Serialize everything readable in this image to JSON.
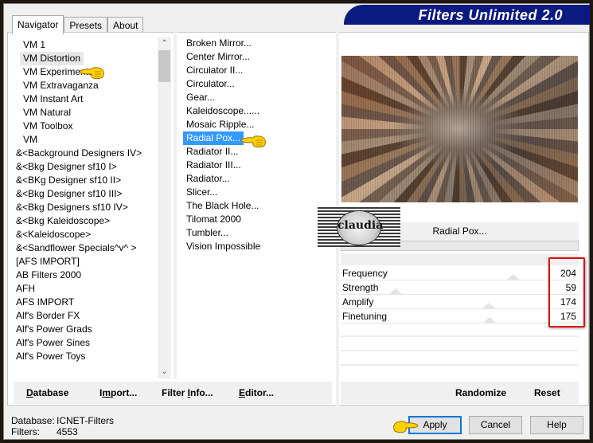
{
  "window": {
    "title": "Filters Unlimited 2.0"
  },
  "tabs": [
    {
      "label": "Navigator",
      "active": true
    },
    {
      "label": "Presets",
      "active": false
    },
    {
      "label": "About",
      "active": false
    }
  ],
  "categories": {
    "selected": "VM Distortion",
    "items": [
      "VM 1",
      "VM Distortion",
      "VM Experimental",
      "VM Extravaganza",
      "VM Instant Art",
      "VM Natural",
      "VM Toolbox",
      "VM",
      "&<Background Designers IV>",
      "&<Bkg Designer sf10 I>",
      "&<BKg Designer sf10 II>",
      "&<Bkg Designer sf10 III>",
      "&<Bkg Designers sf10 IV>",
      "&<Bkg Kaleidoscope>",
      "&<Kaleidoscope>",
      "&<Sandflower Specials^v^ >",
      "[AFS IMPORT]",
      "AB Filters 2000",
      "AFH",
      "AFS IMPORT",
      "Alf's Border FX",
      "Alf's Power Grads",
      "Alf's Power Sines",
      "Alf's Power Toys"
    ]
  },
  "filters": {
    "selected": "Radial Pox...",
    "items": [
      "Broken Mirror...",
      "Center Mirror...",
      "Circulator II...",
      "Circulator...",
      "Gear...",
      "Kaleidoscope......",
      "Mosaic Ripple...",
      "Radial Pox...",
      "Radiator II...",
      "Radiator III...",
      "Radiator...",
      "Slicer...",
      "The Black Hole...",
      "Tilomat 2000",
      "Tumbler...",
      "Vision Impossible"
    ]
  },
  "preview": {
    "filter_name": "Radial Pox..."
  },
  "watermark": {
    "text": "claudia"
  },
  "parameters": [
    {
      "label": "Frequency",
      "value": 204
    },
    {
      "label": "Strength",
      "value": 59
    },
    {
      "label": "Amplify",
      "value": 174
    },
    {
      "label": "Finetuning",
      "value": 175
    }
  ],
  "parameter_max": 255,
  "left_buttons": [
    {
      "label": "Database",
      "underline": "D"
    },
    {
      "label": "Import...",
      "underline": "m"
    },
    {
      "label": "Filter Info...",
      "underline": "I"
    },
    {
      "label": "Editor...",
      "underline": "E"
    }
  ],
  "right_buttons": {
    "randomize": "Randomize",
    "reset": "Reset"
  },
  "status": {
    "database_label": "Database:",
    "database_value": "ICNET-Filters",
    "filters_label": "Filters:",
    "filters_value": "4553"
  },
  "dialog_buttons": {
    "apply": "Apply",
    "cancel": "Cancel",
    "help": "Help"
  },
  "colors": {
    "banner": "#0b1a80",
    "selection": "#3399ff",
    "highlight": "#e00000",
    "default_button_border": "#0078d7"
  }
}
